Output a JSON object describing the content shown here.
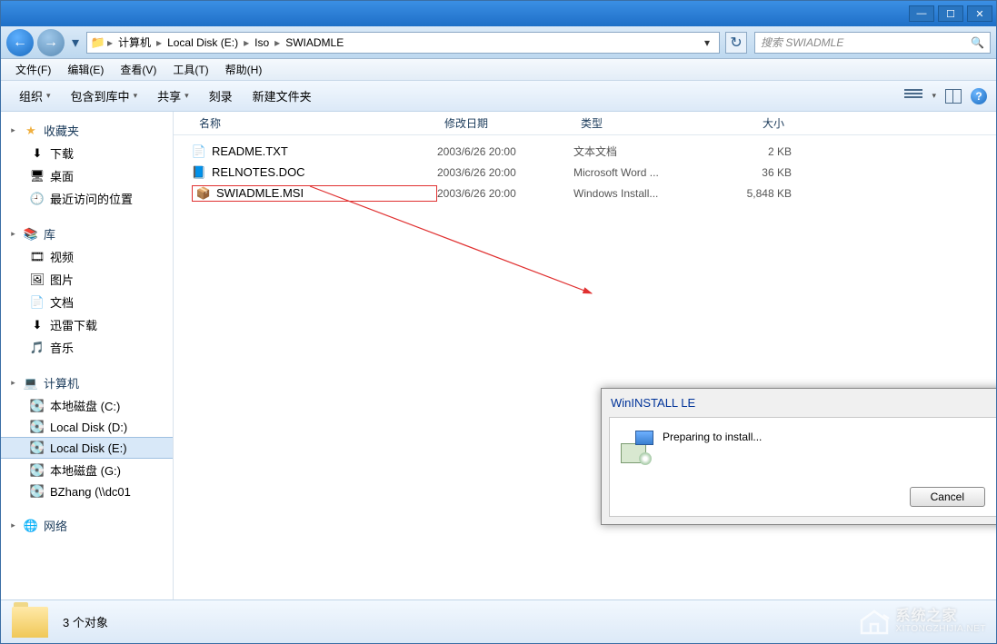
{
  "titlebar": {
    "min": "—",
    "max": "☐",
    "close": "✕"
  },
  "nav": {
    "back": "←",
    "forward": "→",
    "dropdown": "▾"
  },
  "breadcrumb": {
    "items": [
      "计算机",
      "Local Disk (E:)",
      "Iso",
      "SWIADMLE"
    ],
    "sep": "▸",
    "folder_icon": "📁",
    "addr_dd": "▾",
    "refresh": "↻"
  },
  "search": {
    "placeholder": "搜索 SWIADMLE",
    "icon": "🔍"
  },
  "menubar": [
    "文件(F)",
    "编辑(E)",
    "查看(V)",
    "工具(T)",
    "帮助(H)"
  ],
  "toolbar": {
    "organize": "组织",
    "include": "包含到库中",
    "share": "共享",
    "burn": "刻录",
    "newfolder": "新建文件夹",
    "dd": "▾",
    "help": "?"
  },
  "sidebar": {
    "favorites": {
      "label": "收藏夹",
      "icon": "★",
      "items": [
        {
          "icon": "⬇",
          "label": "下载"
        },
        {
          "icon": "🖥",
          "label": "桌面"
        },
        {
          "icon": "🕘",
          "label": "最近访问的位置"
        }
      ]
    },
    "libraries": {
      "label": "库",
      "icon": "📚",
      "items": [
        {
          "icon": "🎞",
          "label": "视频"
        },
        {
          "icon": "🖼",
          "label": "图片"
        },
        {
          "icon": "📄",
          "label": "文档"
        },
        {
          "icon": "⬇",
          "label": "迅雷下载"
        },
        {
          "icon": "🎵",
          "label": "音乐"
        }
      ]
    },
    "computer": {
      "label": "计算机",
      "icon": "💻",
      "items": [
        {
          "icon": "💽",
          "label": "本地磁盘 (C:)"
        },
        {
          "icon": "💽",
          "label": "Local Disk (D:)"
        },
        {
          "icon": "💽",
          "label": "Local Disk (E:)",
          "selected": true
        },
        {
          "icon": "💽",
          "label": "本地磁盘 (G:)"
        },
        {
          "icon": "💽",
          "label": "BZhang (\\\\dc01"
        }
      ]
    },
    "network": {
      "label": "网络",
      "icon": "🌐"
    },
    "exp": "▸"
  },
  "columns": {
    "name": "名称",
    "date": "修改日期",
    "type": "类型",
    "size": "大小"
  },
  "files": [
    {
      "icon": "📄",
      "name": "README.TXT",
      "date": "2003/6/26 20:00",
      "type": "文本文档",
      "size": "2 KB"
    },
    {
      "icon": "📘",
      "name": "RELNOTES.DOC",
      "date": "2003/6/26 20:00",
      "type": "Microsoft Word ...",
      "size": "36 KB"
    },
    {
      "icon": "📦",
      "name": "SWIADMLE.MSI",
      "date": "2003/6/26 20:00",
      "type": "Windows Install...",
      "size": "5,848 KB",
      "highlighted": true
    }
  ],
  "dialog": {
    "title": "WinINSTALL LE",
    "message": "Preparing to install...",
    "cancel": "Cancel"
  },
  "statusbar": {
    "text": "3 个对象"
  },
  "watermark": {
    "cn": "系统之家",
    "en": "XITONGZHIJIA.NET"
  }
}
